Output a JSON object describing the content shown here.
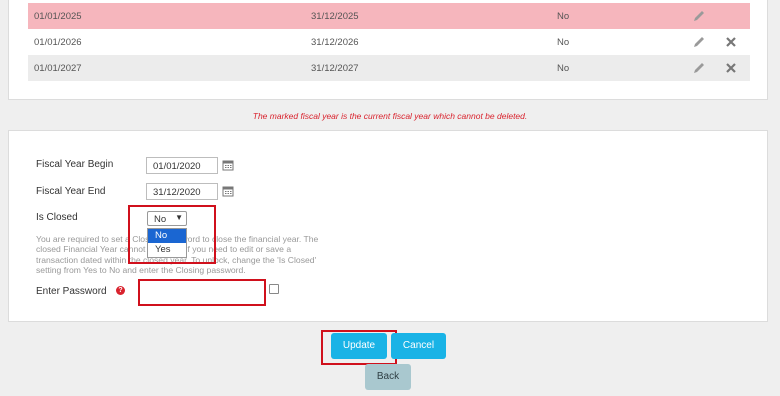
{
  "fiscal_years": {
    "rows": [
      {
        "begin": "01/01/2025",
        "end": "31/12/2025",
        "closed": "No",
        "current": true
      },
      {
        "begin": "01/01/2026",
        "end": "31/12/2026",
        "closed": "No",
        "current": false
      },
      {
        "begin": "01/01/2027",
        "end": "31/12/2027",
        "closed": "No",
        "current": false
      }
    ],
    "notice": "The marked fiscal year is the current fiscal year which cannot be deleted."
  },
  "form": {
    "begin_label": "Fiscal Year Begin",
    "begin_value": "01/01/2020",
    "end_label": "Fiscal Year End",
    "end_value": "31/12/2020",
    "closed_label": "Is Closed",
    "closed_value": "No",
    "closed_options": [
      "No",
      "Yes"
    ],
    "help_text": "You are required to set a Closing password to close the financial year. The closed Financial Year cannot be edited if you need to edit or save a transaction dated within the closed year. To unlock, change the 'Is Closed' setting from Yes to No and enter the Closing password.",
    "password_label": "Enter Password",
    "password_value": ""
  },
  "buttons": {
    "update": "Update",
    "cancel": "Cancel",
    "back": "Back"
  },
  "colors": {
    "current_row": "#f6b6bd",
    "primary_button": "#19b3e6",
    "highlight_box": "#d0101c",
    "notice_text": "#d9232e"
  },
  "icons": {
    "edit": "pencil-icon",
    "delete": "close-icon",
    "calendar": "calendar-icon",
    "help": "question-icon",
    "dropdown": "chevron-down-icon"
  }
}
